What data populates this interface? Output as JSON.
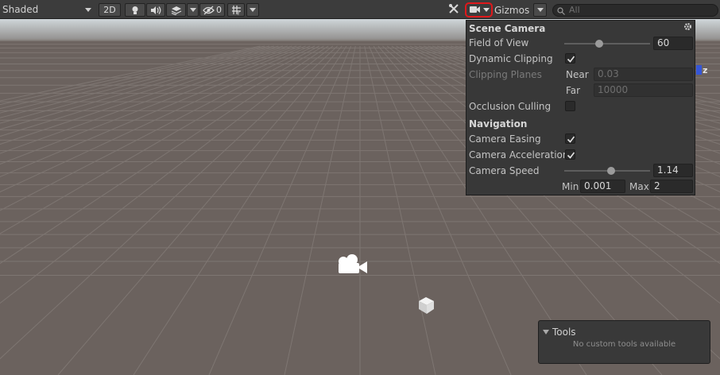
{
  "toolbar": {
    "shading_mode": "Shaded",
    "two_d_label": "2D",
    "hidden_count": "0",
    "gizmos_label": "Gizmos",
    "search_placeholder": "All",
    "icons": [
      "lightbulb-icon",
      "speaker-icon",
      "layers-icon",
      "hidden-eye-icon",
      "grid-icon",
      "tools-icon",
      "camera-icon",
      "search-icon"
    ]
  },
  "scene_camera_overlay": {
    "title": "Scene Camera",
    "field_of_view_label": "Field of View",
    "field_of_view_value": "60",
    "field_of_view_slider_fraction": 0.4,
    "dynamic_clipping_label": "Dynamic Clipping",
    "dynamic_clipping_checked": true,
    "clipping_planes_label": "Clipping Planes",
    "near_label": "Near",
    "near_value": "0.03",
    "far_label": "Far",
    "far_value": "10000",
    "occlusion_culling_label": "Occlusion Culling",
    "occlusion_culling_checked": false,
    "navigation_header": "Navigation",
    "camera_easing_label": "Camera Easing",
    "camera_easing_checked": true,
    "camera_acceleration_label": "Camera Acceleration",
    "camera_acceleration_checked": true,
    "camera_speed_label": "Camera Speed",
    "camera_speed_value": "1.14",
    "camera_speed_slider_fraction": 0.55,
    "min_label": "Min",
    "min_value": "0.001",
    "max_label": "Max",
    "max_value": "2"
  },
  "scene": {
    "axis_label": "z",
    "ground_color": "#6b625e",
    "sky_color": "#cfd6d9",
    "grid_color": "#7e7672"
  },
  "tools_overlay": {
    "title": "Tools",
    "message": "No custom tools available"
  },
  "accent": {
    "highlight_outline": "#e0181b",
    "axis_blue": "#3556d8"
  }
}
